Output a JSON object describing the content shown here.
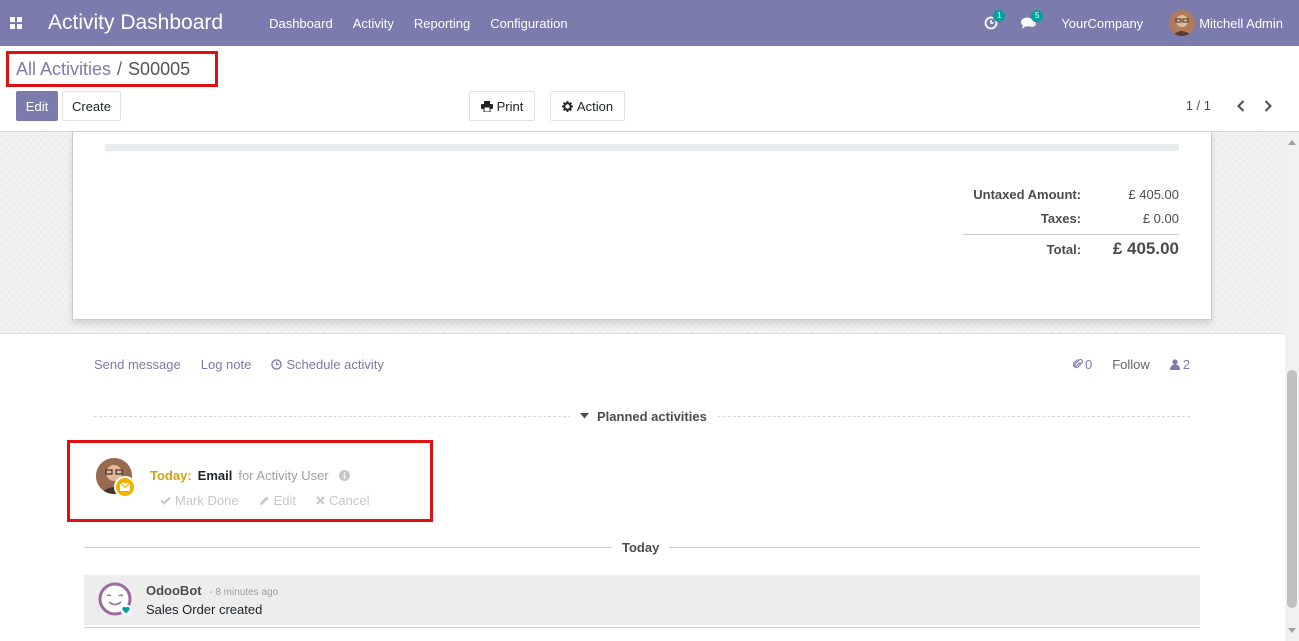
{
  "navbar": {
    "app_title": "Activity Dashboard",
    "menu": [
      "Dashboard",
      "Activity",
      "Reporting",
      "Configuration"
    ],
    "activity_badge": "1",
    "messages_badge": "5",
    "company": "YourCompany",
    "user": "Mitchell Admin"
  },
  "breadcrumb": {
    "parent": "All Activities",
    "separator": "/",
    "current": "S00005"
  },
  "buttons": {
    "edit": "Edit",
    "create": "Create",
    "print": "Print",
    "action": "Action"
  },
  "pager": {
    "value": "1 / 1"
  },
  "totals": {
    "untaxed_label": "Untaxed Amount:",
    "untaxed_value": "£ 405.00",
    "taxes_label": "Taxes:",
    "taxes_value": "£ 0.00",
    "total_label": "Total:",
    "total_value": "£ 405.00"
  },
  "chatter": {
    "send_message": "Send message",
    "log_note": "Log note",
    "schedule_activity": "Schedule activity",
    "attachments_count": "0",
    "follow": "Follow",
    "followers_count": "2",
    "planned_activities": "Planned activities",
    "today_separator": "Today"
  },
  "activity": {
    "when": "Today:",
    "type": "Email",
    "for": "for Activity User",
    "mark_done": "Mark Done",
    "edit": "Edit",
    "cancel": "Cancel"
  },
  "message": {
    "author": "OdooBot",
    "time": "- 8 minutes ago",
    "body": "Sales Order created"
  },
  "colors": {
    "brand": "#7c7bad",
    "highlight_border": "#e01010",
    "today": "#d4a017",
    "badge": "#00a09d"
  }
}
